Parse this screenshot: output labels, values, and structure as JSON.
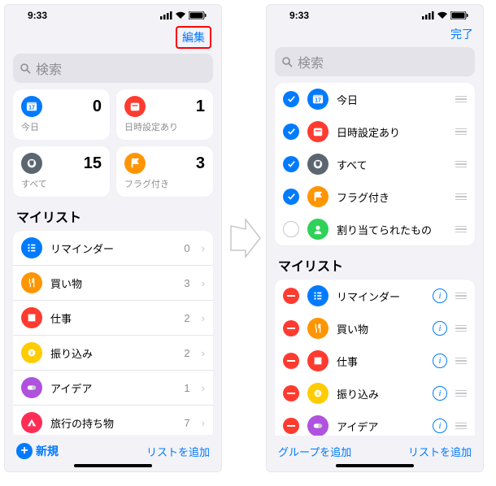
{
  "status_time": "9:33",
  "nav": {
    "edit": "編集",
    "done": "完了"
  },
  "search_placeholder": "検索",
  "smart": {
    "today": {
      "label": "今日",
      "count": 0,
      "color": "#007aff"
    },
    "sched": {
      "label": "日時設定あり",
      "count": 1,
      "color": "#ff3b30"
    },
    "all": {
      "label": "すべて",
      "count": 15,
      "color": "#5b6670"
    },
    "flag": {
      "label": "フラグ付き",
      "count": 3,
      "color": "#ff9500"
    },
    "assigned": {
      "label": "割り当てられたもの",
      "color": "#30d158"
    }
  },
  "mylist_title": "マイリスト",
  "lists": [
    {
      "label": "リマインダー",
      "count": 0,
      "color": "#007aff",
      "icon": "list"
    },
    {
      "label": "買い物",
      "count": 3,
      "color": "#ff9500",
      "icon": "fork"
    },
    {
      "label": "仕事",
      "count": 2,
      "color": "#ff3b30",
      "icon": "book"
    },
    {
      "label": "振り込み",
      "count": 2,
      "color": "#ffcc00",
      "icon": "coin"
    },
    {
      "label": "アイデア",
      "count": 1,
      "color": "#af52de",
      "icon": "pill"
    },
    {
      "label": "旅行の持ち物",
      "count": 7,
      "color": "#ff2d55",
      "icon": "tent"
    }
  ],
  "toolbar": {
    "new": "新規",
    "add_list": "リストを追加",
    "add_group": "グループを追加"
  },
  "smart_checked": {
    "today": true,
    "sched": true,
    "all": true,
    "flag": true,
    "assigned": false
  }
}
